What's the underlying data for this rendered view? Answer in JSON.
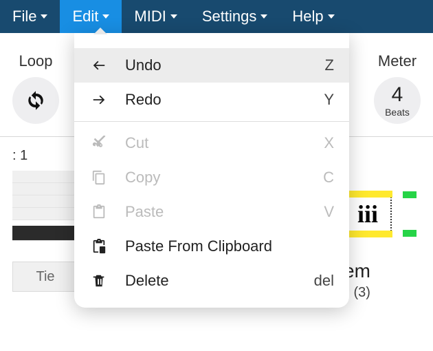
{
  "menubar": {
    "items": [
      {
        "label": "File"
      },
      {
        "label": "Edit"
      },
      {
        "label": "MIDI"
      },
      {
        "label": "Settings"
      },
      {
        "label": "Help"
      }
    ],
    "active_index": 1
  },
  "toolbar": {
    "loop": {
      "label": "Loop"
    },
    "meter": {
      "label": "Meter",
      "value": "4",
      "sub": "Beats"
    }
  },
  "section_label": ": 1",
  "tie_label": "Tie",
  "chord": {
    "roman": "iii",
    "name": "em",
    "count": "(3)"
  },
  "dropdown": {
    "items": [
      {
        "icon": "undo-icon",
        "label": "Undo",
        "shortcut": "Z",
        "enabled": true,
        "hover": true
      },
      {
        "icon": "redo-icon",
        "label": "Redo",
        "shortcut": "Y",
        "enabled": true
      },
      {
        "sep": true
      },
      {
        "icon": "cut-icon",
        "label": "Cut",
        "shortcut": "X",
        "enabled": false
      },
      {
        "icon": "copy-icon",
        "label": "Copy",
        "shortcut": "C",
        "enabled": false
      },
      {
        "icon": "paste-icon",
        "label": "Paste",
        "shortcut": "V",
        "enabled": false
      },
      {
        "icon": "paste-clipboard-icon",
        "label": "Paste From Clipboard",
        "shortcut": "",
        "enabled": true
      },
      {
        "icon": "delete-icon",
        "label": "Delete",
        "shortcut": "del",
        "enabled": true
      }
    ]
  },
  "colors": {
    "menubar_bg": "#184a6f",
    "active_bg": "#188ee3"
  }
}
